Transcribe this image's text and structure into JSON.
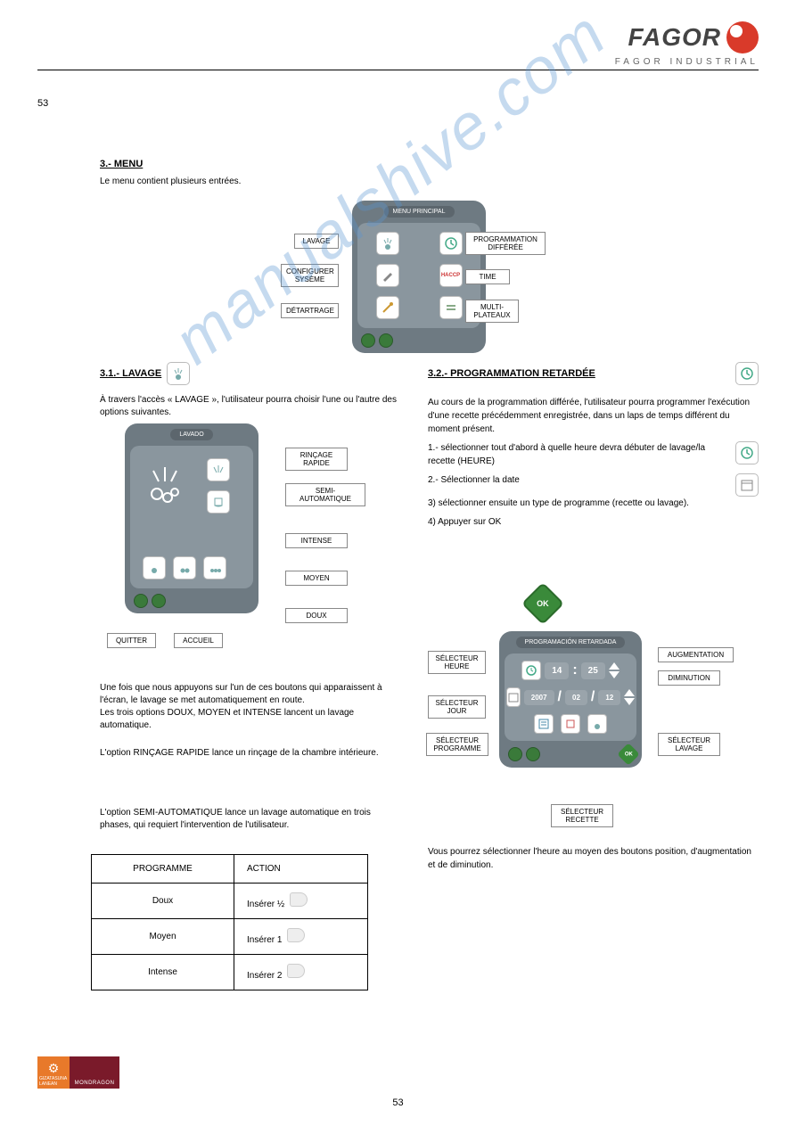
{
  "header": {
    "brand": "FAGOR",
    "subtitle": "FAGOR INDUSTRIAL"
  },
  "page_no_top": "53",
  "section3": {
    "title": "3.- MENU",
    "sub": "Le menu contient plusieurs entrées."
  },
  "menu_panel": {
    "title": "MENU PRINCIPAL",
    "callouts": {
      "lavage": "LAVAGE",
      "prog": "PROGRAMMATION DIFFÉRÉE",
      "config": "CONFIGURER SYSÈME",
      "time": "TIME",
      "detart": "DÉTARTRAGE",
      "multi": "MULTI-PLATEAUX"
    },
    "icons": {
      "lavage": "wash-icon",
      "prog": "clock-prog-icon",
      "config": "wrench-icon",
      "time": "haccp-icon",
      "detart": "descale-icon",
      "multi": "tray-icon"
    }
  },
  "sec31": {
    "heading": "3.1.- LAVAGE",
    "intro": "À travers l'accès « LAVAGE », l'utilisateur pourra choisir l'une ou l'autre des options suivantes.",
    "panel_title": "LAVADO",
    "callouts": {
      "rincage": "RINÇAGE RAPIDE",
      "semi": "SEMI-AUTOMATIQUE",
      "intense": "INTENSE",
      "moyen": "MOYEN",
      "doux": "DOUX",
      "quitter": "QUITTER",
      "accueil": "ACCUEIL"
    },
    "after": "Une fois que nous appuyons sur l'un de ces boutons qui apparaissent à l'écran, le lavage se met automatiquement en route.\nLes trois options DOUX, MOYEN et INTENSE lancent un lavage automatique.",
    "rincage_p": "L'option RINÇAGE RAPIDE lance un rinçage de la chambre intérieure.",
    "semi_p": "L'option SEMI-AUTOMATIQUE lance un lavage automatique en trois phases, qui requiert l'intervention de l'utilisateur.",
    "table": {
      "h1": "PROGRAMME",
      "h2": "ACTION",
      "rows": [
        {
          "prog": "Doux",
          "action": "Insérer ½"
        },
        {
          "prog": "Moyen",
          "action": "Insérer 1"
        },
        {
          "prog": "Intense",
          "action": "Insérer 2"
        }
      ]
    }
  },
  "sec32": {
    "heading": "3.2.- PROGRAMMATION RETARDÉE",
    "intro": "Au cours de la programmation différée, l'utilisateur pourra programmer l'exécution d'une recette précédemment enregistrée, dans un laps de temps différent du moment présent.",
    "p2_a": "1.- sélectionner tout d'abord à quelle heure devra débuter de lavage/la recette (HEURE)",
    "p2_b": "2.- Sélectionner la date",
    "p3": "3) sélectionner ensuite un type de programme (recette ou lavage).",
    "p4": "4) Appuyer sur OK",
    "panel_title": "PROGRAMACIÓN RETARDADA",
    "time_hh": "14",
    "time_mm": "25",
    "date_y": "2007",
    "date_m": "02",
    "date_d": "12",
    "callouts": {
      "sel_heure": "SÉLECTEUR HEURE",
      "augment": "AUGMENTATION",
      "dimin": "DIMINUTION",
      "sel_jour": "SÉLECTEUR JOUR",
      "sel_prog": "SÉLECTEUR PROGRAMME",
      "sel_lavage": "SÉLECTEUR LAVAGE",
      "sel_recette": "SÉLECTEUR RECETTE"
    },
    "after": "Vous pourrez sélectionner l'heure au moyen des boutons position, d'augmentation et de diminution."
  },
  "ok_label": "OK",
  "watermark": "manualshive.com",
  "footer": {
    "fl1": "GIZATASUNA LANEAN",
    "fl2": "MONDRAGON",
    "page": "53"
  }
}
